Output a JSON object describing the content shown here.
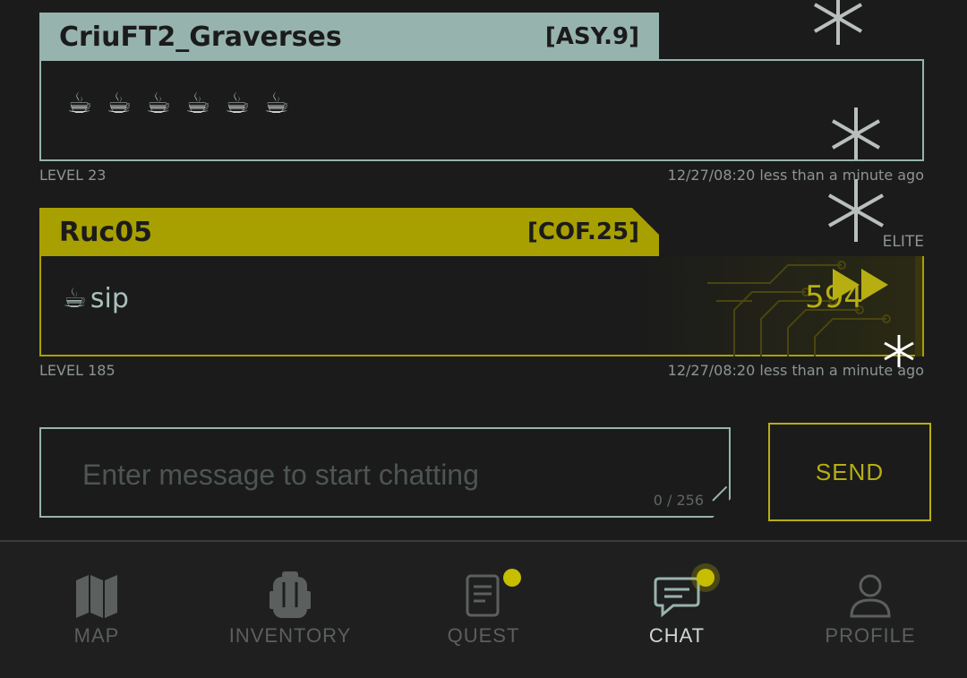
{
  "messages": [
    {
      "username": "CriuFT2_Graverses",
      "tag": "[ASY.9]",
      "cups": [
        "☕",
        "☕",
        "☕",
        "☕",
        "☕",
        "☕"
      ],
      "level": "LEVEL 23",
      "timestamp": "12/27/08:20 less than a minute ago"
    },
    {
      "username": "Ruc05",
      "tag": "[COF.25]",
      "text_emoji": "☕",
      "text": "sip",
      "badge": "ELITE",
      "score": "594",
      "level": "LEVEL 185",
      "timestamp": "12/27/08:20 less than a minute ago"
    }
  ],
  "composer": {
    "placeholder": "Enter message to start chatting",
    "counter": "0 / 256",
    "send_label": "SEND"
  },
  "nav": {
    "items": [
      {
        "label": "MAP",
        "icon": "map-icon"
      },
      {
        "label": "INVENTORY",
        "icon": "backpack-icon"
      },
      {
        "label": "QUEST",
        "icon": "document-icon"
      },
      {
        "label": "CHAT",
        "icon": "chat-icon"
      },
      {
        "label": "PROFILE",
        "icon": "person-icon"
      }
    ],
    "active": "CHAT"
  },
  "colors": {
    "accent": "#a8a000",
    "teal": "#97b3ad",
    "background": "#1b1b1b"
  }
}
